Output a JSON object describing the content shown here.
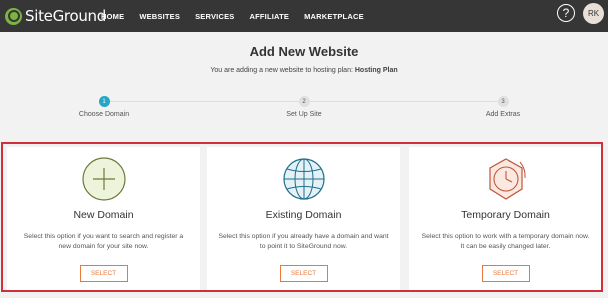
{
  "brand": {
    "logo_text": "SiteGround",
    "accent": "#e6793f",
    "highlight": "#d22f3d"
  },
  "nav": [
    "HOME",
    "WEBSITES",
    "SERVICES",
    "AFFILIATE",
    "MARKETPLACE"
  ],
  "header": {
    "help_icon": "?",
    "avatar_initials": "RK"
  },
  "page": {
    "title": "Add New Website",
    "subtitle_prefix": "You are adding a new website to hosting plan:",
    "subtitle_plan": "Hosting Plan"
  },
  "steps": [
    {
      "number": "1",
      "label": "Choose Domain",
      "active": true
    },
    {
      "number": "2",
      "label": "Set Up Site",
      "active": false
    },
    {
      "number": "3",
      "label": "Add Extras",
      "active": false
    }
  ],
  "cards": [
    {
      "icon": "plus-circle-icon",
      "title": "New Domain",
      "description": "Select this option if you want to search and register a new domain for your site now.",
      "button": "SELECT"
    },
    {
      "icon": "globe-icon",
      "title": "Existing Domain",
      "description": "Select this option if you already have a domain and want to point it to SiteGround now.",
      "button": "SELECT"
    },
    {
      "icon": "clock-icon",
      "title": "Temporary Domain",
      "description": "Select this option to work with a temporary domain now. It can be easily changed later.",
      "button": "SELECT"
    }
  ]
}
